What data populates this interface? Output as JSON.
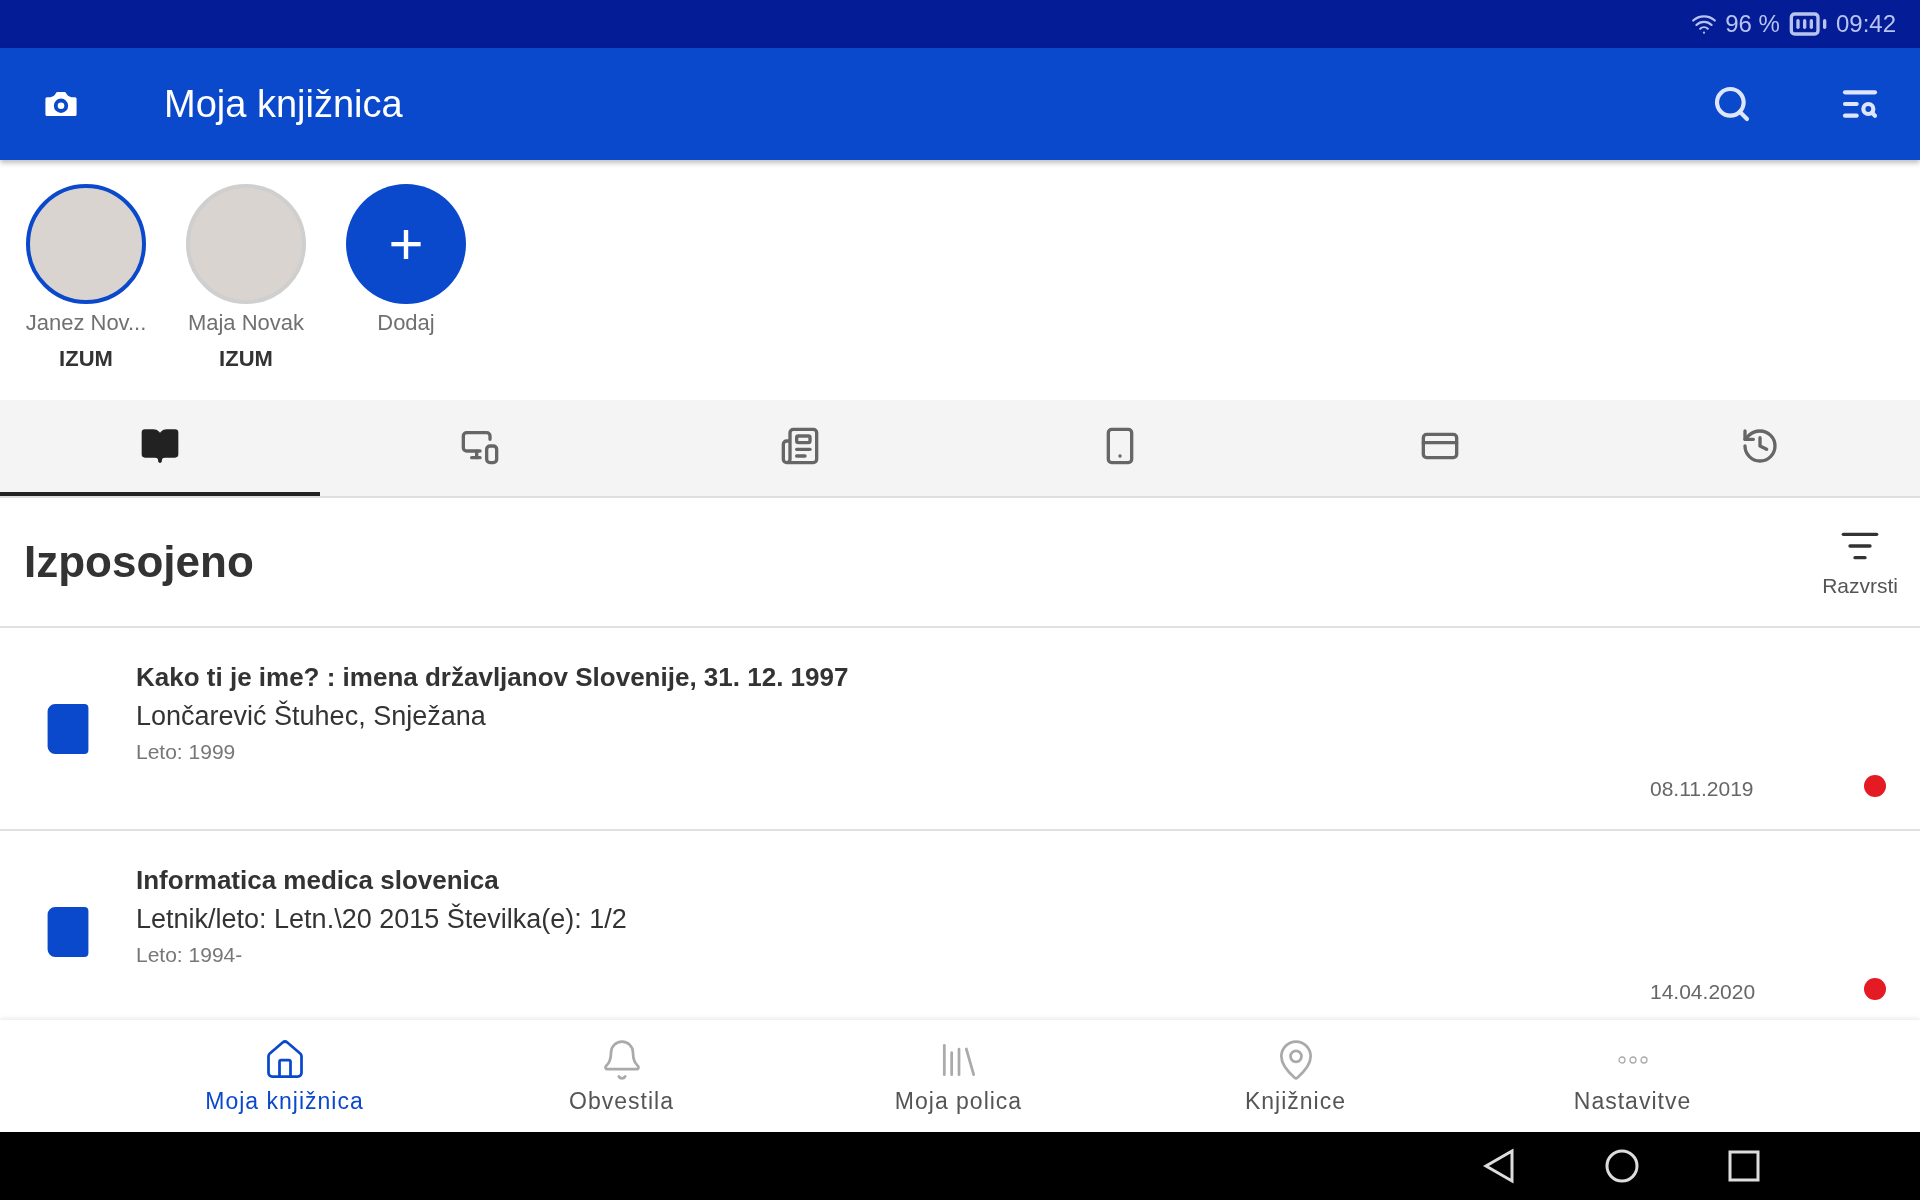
{
  "status_bar": {
    "battery": "96 %",
    "time": "09:42"
  },
  "app_bar": {
    "title": "Moja knjižnica"
  },
  "profiles": [
    {
      "kind": "person",
      "name": "Janez Nov...",
      "library": "IZUM",
      "selected": true
    },
    {
      "kind": "person",
      "name": "Maja Novak",
      "library": "IZUM",
      "selected": false
    },
    {
      "kind": "add",
      "symbol": "+",
      "name": "Dodaj"
    }
  ],
  "tabs": [
    {
      "kind": "reader",
      "selected": true
    },
    {
      "kind": "devices",
      "selected": false
    },
    {
      "kind": "news",
      "selected": false
    },
    {
      "kind": "phone",
      "selected": false
    },
    {
      "kind": "card",
      "selected": false
    },
    {
      "kind": "history",
      "selected": false
    }
  ],
  "section": {
    "title": "Izposojeno",
    "sort_label": "Razvrsti"
  },
  "loans": [
    {
      "title": "Kako ti je ime? : imena državljanov Slovenije, 31. 12. 1997",
      "subtitle": "Lončarević Štuhec, Snježana",
      "year": "Leto: 1999",
      "date": "08.11.2019",
      "color": "#e41b23"
    },
    {
      "title": "Informatica medica slovenica",
      "subtitle": "Letnik/leto: Letn.\\20 2015 Številka(e): 1/2",
      "year": "Leto: 1994-",
      "date": "14.04.2020",
      "color": "#e41b23"
    }
  ],
  "bottom_nav": [
    {
      "kind": "home",
      "label": "Moja knjižnica",
      "selected": true
    },
    {
      "kind": "bell",
      "label": "Obvestila",
      "selected": false
    },
    {
      "kind": "shelf",
      "label": "Moja polica",
      "selected": false
    },
    {
      "kind": "pin",
      "label": "Knjižnice",
      "selected": false
    },
    {
      "kind": "more",
      "label": "Nastavitve",
      "selected": false
    }
  ]
}
